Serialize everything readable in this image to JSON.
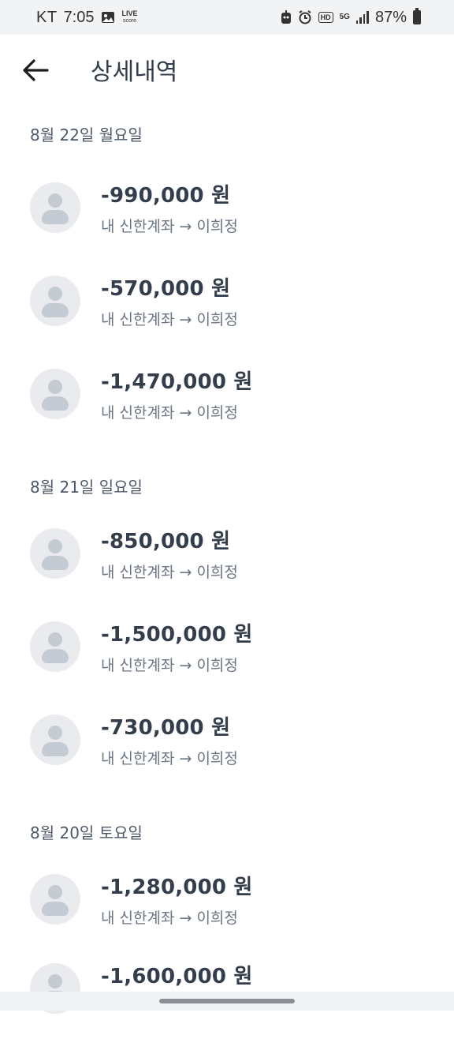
{
  "status_bar": {
    "carrier": "KT",
    "time": "7:05",
    "live_text": "LIVE",
    "live_sub": "score",
    "hd_tag": "HD",
    "net_tag": "5G",
    "battery": "87%"
  },
  "header": {
    "title": "상세내역",
    "back_icon": "arrow-left-icon"
  },
  "groups": [
    {
      "date": "8월 22일 월요일",
      "items": [
        {
          "amount": "-990,000 원",
          "desc": "내 신한계좌 → 이희정"
        },
        {
          "amount": "-570,000 원",
          "desc": "내 신한계좌 → 이희정"
        },
        {
          "amount": "-1,470,000 원",
          "desc": "내 신한계좌 → 이희정"
        }
      ]
    },
    {
      "date": "8월 21일 일요일",
      "items": [
        {
          "amount": "-850,000 원",
          "desc": "내 신한계좌 → 이희정"
        },
        {
          "amount": "-1,500,000 원",
          "desc": "내 신한계좌 → 이희정"
        },
        {
          "amount": "-730,000 원",
          "desc": "내 신한계좌 → 이희정"
        }
      ]
    },
    {
      "date": "8월 20일 토요일",
      "items": [
        {
          "amount": "-1,280,000 원",
          "desc": "내 신한계좌 → 이희정"
        },
        {
          "amount": "-1,600,000 원",
          "desc": ""
        }
      ]
    }
  ],
  "colors": {
    "text_primary": "#333d4b",
    "text_secondary": "#6b7684",
    "avatar_bg": "#e9ebee",
    "avatar_fg": "#c5cbd2"
  }
}
